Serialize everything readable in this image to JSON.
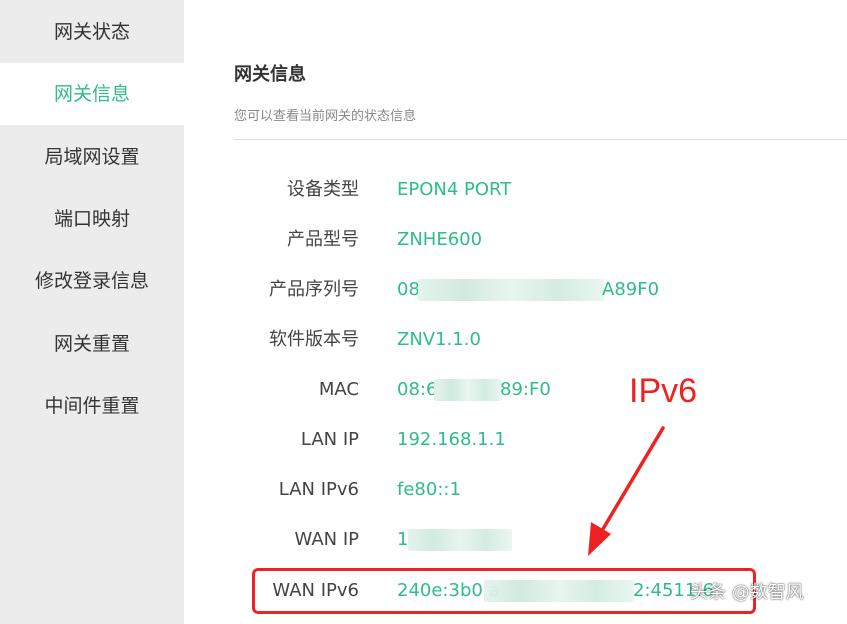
{
  "sidebar": {
    "items": [
      {
        "label": "网关状态",
        "active": false
      },
      {
        "label": "网关信息",
        "active": true
      },
      {
        "label": "局域网设置",
        "active": false
      },
      {
        "label": "端口映射",
        "active": false
      },
      {
        "label": "修改登录信息",
        "active": false
      },
      {
        "label": "网关重置",
        "active": false
      },
      {
        "label": "中间件重置",
        "active": false
      }
    ]
  },
  "main": {
    "title": "网关信息",
    "subtitle": "您可以查看当前网关的状态信息",
    "rows": [
      {
        "label": "设备类型",
        "value": "EPON4 PORT"
      },
      {
        "label": "产品型号",
        "value": "ZNHE600"
      },
      {
        "label": "产品序列号",
        "value": "08",
        "value_suffix": "A89F0"
      },
      {
        "label": "软件版本号",
        "value": "ZNV1.1.0"
      },
      {
        "label": "MAC",
        "value": "08:6",
        "value_suffix": "89:F0"
      },
      {
        "label": "LAN IP",
        "value": "192.168.1.1"
      },
      {
        "label": "LAN IPv6",
        "value": "fe80::1"
      },
      {
        "label": "WAN IP",
        "value": "1"
      },
      {
        "label": "WAN IPv6",
        "value": "240e:3b0:a",
        "value_suffix": "2:4511:6"
      }
    ]
  },
  "annotation": {
    "text": "IPv6",
    "color": "#ee2222"
  },
  "watermark": {
    "text": "头条 @数智风"
  },
  "colors": {
    "accent": "#2ebd86",
    "sidebar_bg": "#ececec",
    "annotation": "#ee2222"
  }
}
